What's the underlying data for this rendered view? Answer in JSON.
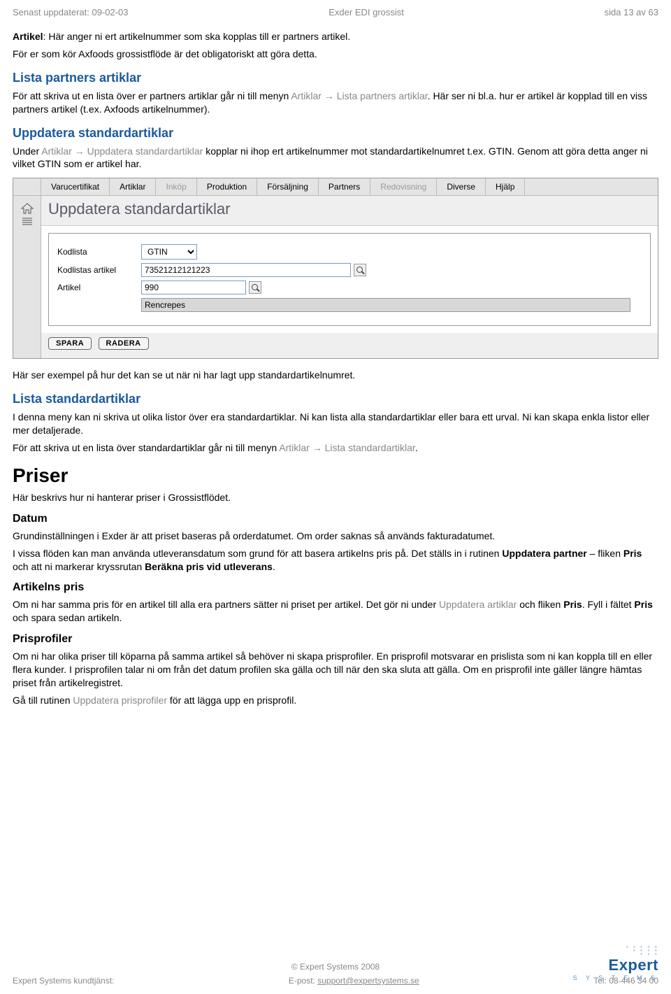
{
  "header": {
    "updated": "Senast uppdaterat: 09-02-03",
    "title": "Exder EDI grossist",
    "page": "sida 13 av 63"
  },
  "intro": {
    "artikel_prefix": "Artikel",
    "artikel_rest": ": Här anger ni ert artikelnummer som ska kopplas till er partners artikel.",
    "line2": "För er som kör Axfoods grossistflöde är det obligatoriskt att göra detta."
  },
  "lista_partners": {
    "heading": "Lista partners artiklar",
    "p_before": "För att skriva ut en lista över er partners artiklar går ni till menyn ",
    "menu1": "Artiklar",
    "arrow": " → ",
    "menu2": "Lista partners artiklar",
    "p_after": ". Här ser ni bl.a. hur er artikel är kopplad till en viss partners artikel (t.ex. Axfoods artikelnummer)."
  },
  "uppdatera": {
    "heading": "Uppdatera standardartiklar",
    "p_before": "Under ",
    "menu1": "Artiklar",
    "arrow": " → ",
    "menu2": "Uppdatera standardartiklar",
    "p_after": " kopplar ni ihop ert artikelnummer mot standardartikelnumret t.ex. GTIN. Genom att göra detta anger ni vilket GTIN som er artikel har."
  },
  "app": {
    "tabs": [
      "Varucertifikat",
      "Artiklar",
      "Inköp",
      "Produktion",
      "Försäljning",
      "Partners",
      "Redovisning",
      "Diverse",
      "Hjälp"
    ],
    "dim_tabs": [
      2,
      6
    ],
    "panel_title": "Uppdatera standardartiklar",
    "labels": {
      "kodlista": "Kodlista",
      "kodlistas_artikel": "Kodlistas artikel",
      "artikel": "Artikel"
    },
    "values": {
      "kodlista": "GTIN",
      "kodlistas_artikel": "73521212121223",
      "artikel": "990",
      "artikel_name": "Rencrepes"
    },
    "buttons": {
      "spara": "SPARA",
      "radera": "RADERA"
    }
  },
  "after_img": "Här ser exempel på hur det kan se ut när ni har lagt upp standardartikelnumret.",
  "lista_std": {
    "heading": "Lista standardartiklar",
    "p1": "I denna meny kan ni skriva ut olika listor över era standardartiklar. Ni kan lista alla standardartiklar eller bara ett urval. Ni kan skapa enkla listor eller mer detaljerade.",
    "p2_before": "För att skriva ut en lista över standardartiklar går ni till menyn ",
    "menu1": "Artiklar",
    "arrow": " → ",
    "menu2": "Lista standardartiklar",
    "p2_after": "."
  },
  "priser": {
    "heading": "Priser",
    "sub": "Här beskrivs hur ni hanterar priser i Grossistflödet."
  },
  "datum": {
    "heading": "Datum",
    "p1": "Grundinställningen i Exder är att priset baseras på orderdatumet. Om order saknas så används fakturadatumet.",
    "p2_a": "I vissa flöden kan man använda utleveransdatum som grund för att basera artikelns pris på. Det ställs in i rutinen ",
    "p2_b1": "Uppdatera partner",
    "p2_c": " – fliken ",
    "p2_b2": "Pris",
    "p2_d": " och att ni markerar kryssrutan ",
    "p2_b3": "Beräkna pris vid utleverans",
    "p2_e": "."
  },
  "artpris": {
    "heading": "Artikelns pris",
    "p_a": "Om ni har samma pris för en artikel till alla era partners sätter ni priset per artikel. Det gör ni under ",
    "menu": "Uppdatera artiklar",
    "p_b": " och fliken ",
    "b1": "Pris",
    "p_c": ". Fyll i fältet ",
    "b2": "Pris",
    "p_d": " och spara sedan artikeln."
  },
  "prisprofiler": {
    "heading": "Prisprofiler",
    "p1": "Om ni har olika priser till köparna på samma artikel så behöver ni skapa prisprofiler. En prisprofil motsvarar en prislista som ni kan koppla till en eller flera kunder. I prisprofilen talar ni om från det datum profilen ska gälla och till när den ska sluta att gälla. Om en prisprofil inte gäller längre hämtas priset från artikelregistret.",
    "p2_a": "Gå till rutinen ",
    "menu": "Uppdatera prisprofiler",
    "p2_b": " för att lägga upp en prisprofil."
  },
  "footer": {
    "copyright": "© Expert Systems 2008",
    "left": "Expert Systems kundtjänst:",
    "mid_label": "E-post: ",
    "mid_link": "support@expertsystems.se",
    "right": "Tel: 08-446 34 00",
    "logo_name": "Expert",
    "logo_sys": "S Y S T E M S"
  }
}
